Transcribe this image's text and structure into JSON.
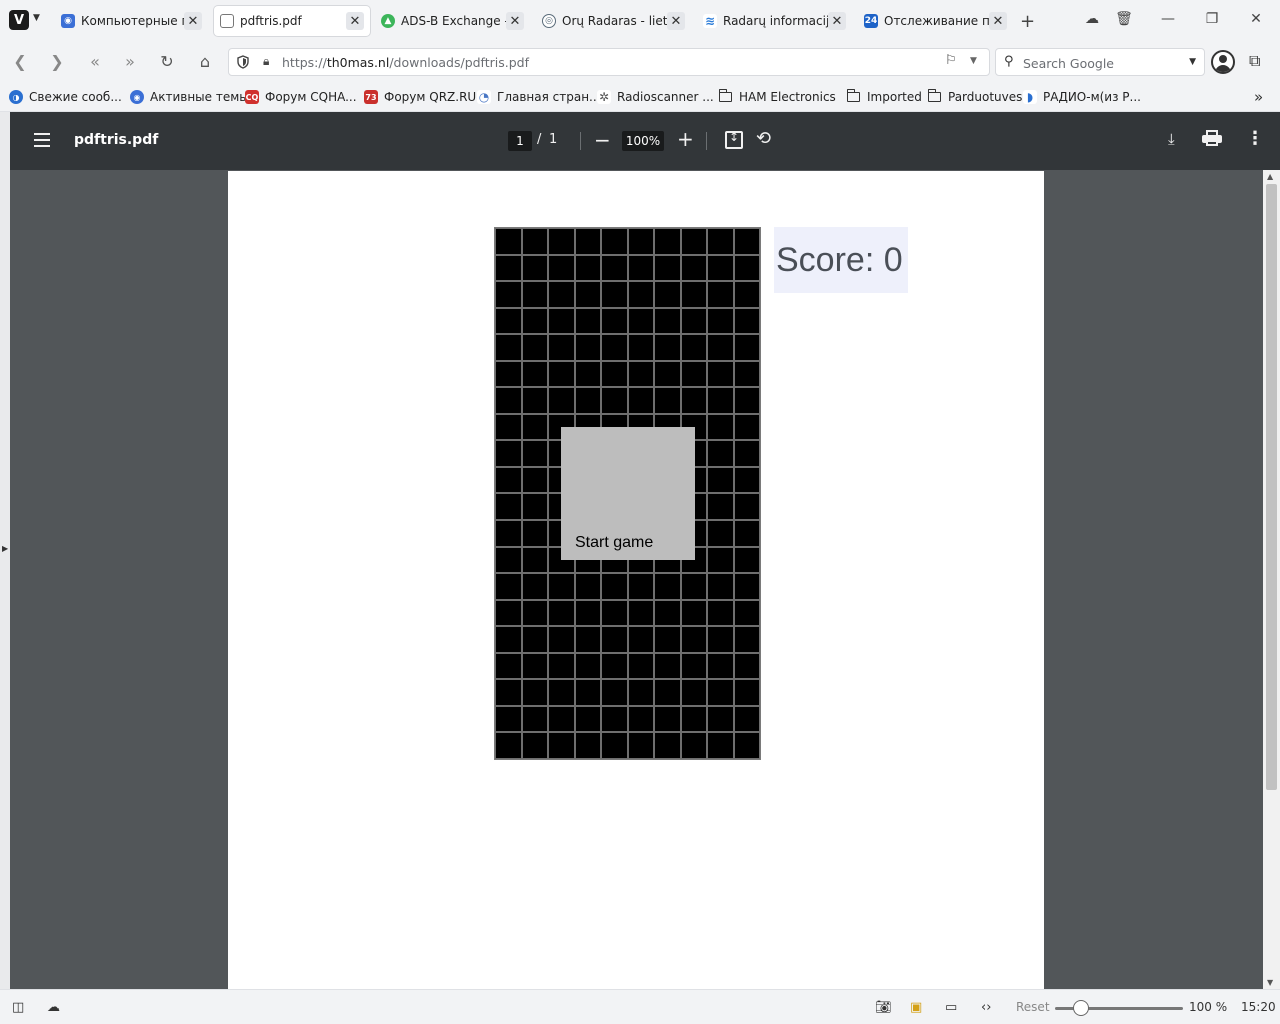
{
  "browser": {
    "tabs": [
      {
        "title": "Компьютерные пр",
        "favicon_color": "#3b6fd6",
        "active": false
      },
      {
        "title": "pdftris.pdf",
        "favicon_color": "#ffffff",
        "active": true
      },
      {
        "title": "ADS-B Exchange - t",
        "favicon_color": "#3cb55a",
        "active": false
      },
      {
        "title": "Orų Radaras - lietu",
        "favicon_color": "#5a6b7a",
        "active": false
      },
      {
        "title": "Radarų informacija",
        "favicon_color": "#2a7bd8",
        "active": false
      },
      {
        "title": "Отслеживание по",
        "favicon_color": "#1e63c8",
        "active": false
      }
    ],
    "tab_favicon_glyphs": {
      "tab6": "24"
    },
    "url": {
      "prefix": "https://",
      "host": "th0mas.nl",
      "path": "/downloads/pdftris.pdf"
    },
    "search_placeholder": "Search Google",
    "bookmarks": [
      {
        "label": "Свежие сооб...",
        "icon": "site",
        "color": "#2a6fd0"
      },
      {
        "label": "Активные темы",
        "icon": "site",
        "color": "#3b6fd6"
      },
      {
        "label": "Форум CQHA...",
        "icon": "site",
        "color": "#d0312d",
        "glyph": "CQ"
      },
      {
        "label": "Форум QRZ.RU",
        "icon": "site",
        "color": "#c9302c",
        "glyph": "73"
      },
      {
        "label": "Главная стран...",
        "icon": "site",
        "color": "#4a77c4"
      },
      {
        "label": "Radioscanner ...",
        "icon": "site",
        "color": "#555555"
      },
      {
        "label": "HAM Electronics",
        "icon": "folder"
      },
      {
        "label": "Imported",
        "icon": "folder"
      },
      {
        "label": "Parduotuves",
        "icon": "folder"
      },
      {
        "label": "РАДИО-м(из Р...",
        "icon": "site",
        "color": "#2a6fd0"
      }
    ]
  },
  "pdf_toolbar": {
    "file_name": "pdftris.pdf",
    "page_current": "1",
    "page_separator": "/",
    "page_total": "1",
    "zoom": "100%"
  },
  "game": {
    "columns": 10,
    "rows": 20,
    "score_text": "Score: 0",
    "start_label": "Start game"
  },
  "status_bar": {
    "reset_label": "Reset",
    "zoom_percent": "100 %",
    "zoom_level": 1.0,
    "clock": "15:20"
  },
  "colors": {
    "pdf_toolbar_bg": "#323639",
    "viewer_bg": "#525659",
    "grid_bg": "#000000",
    "start_box_bg": "#bdbdbd",
    "score_box_bg": "#eef0fb"
  }
}
